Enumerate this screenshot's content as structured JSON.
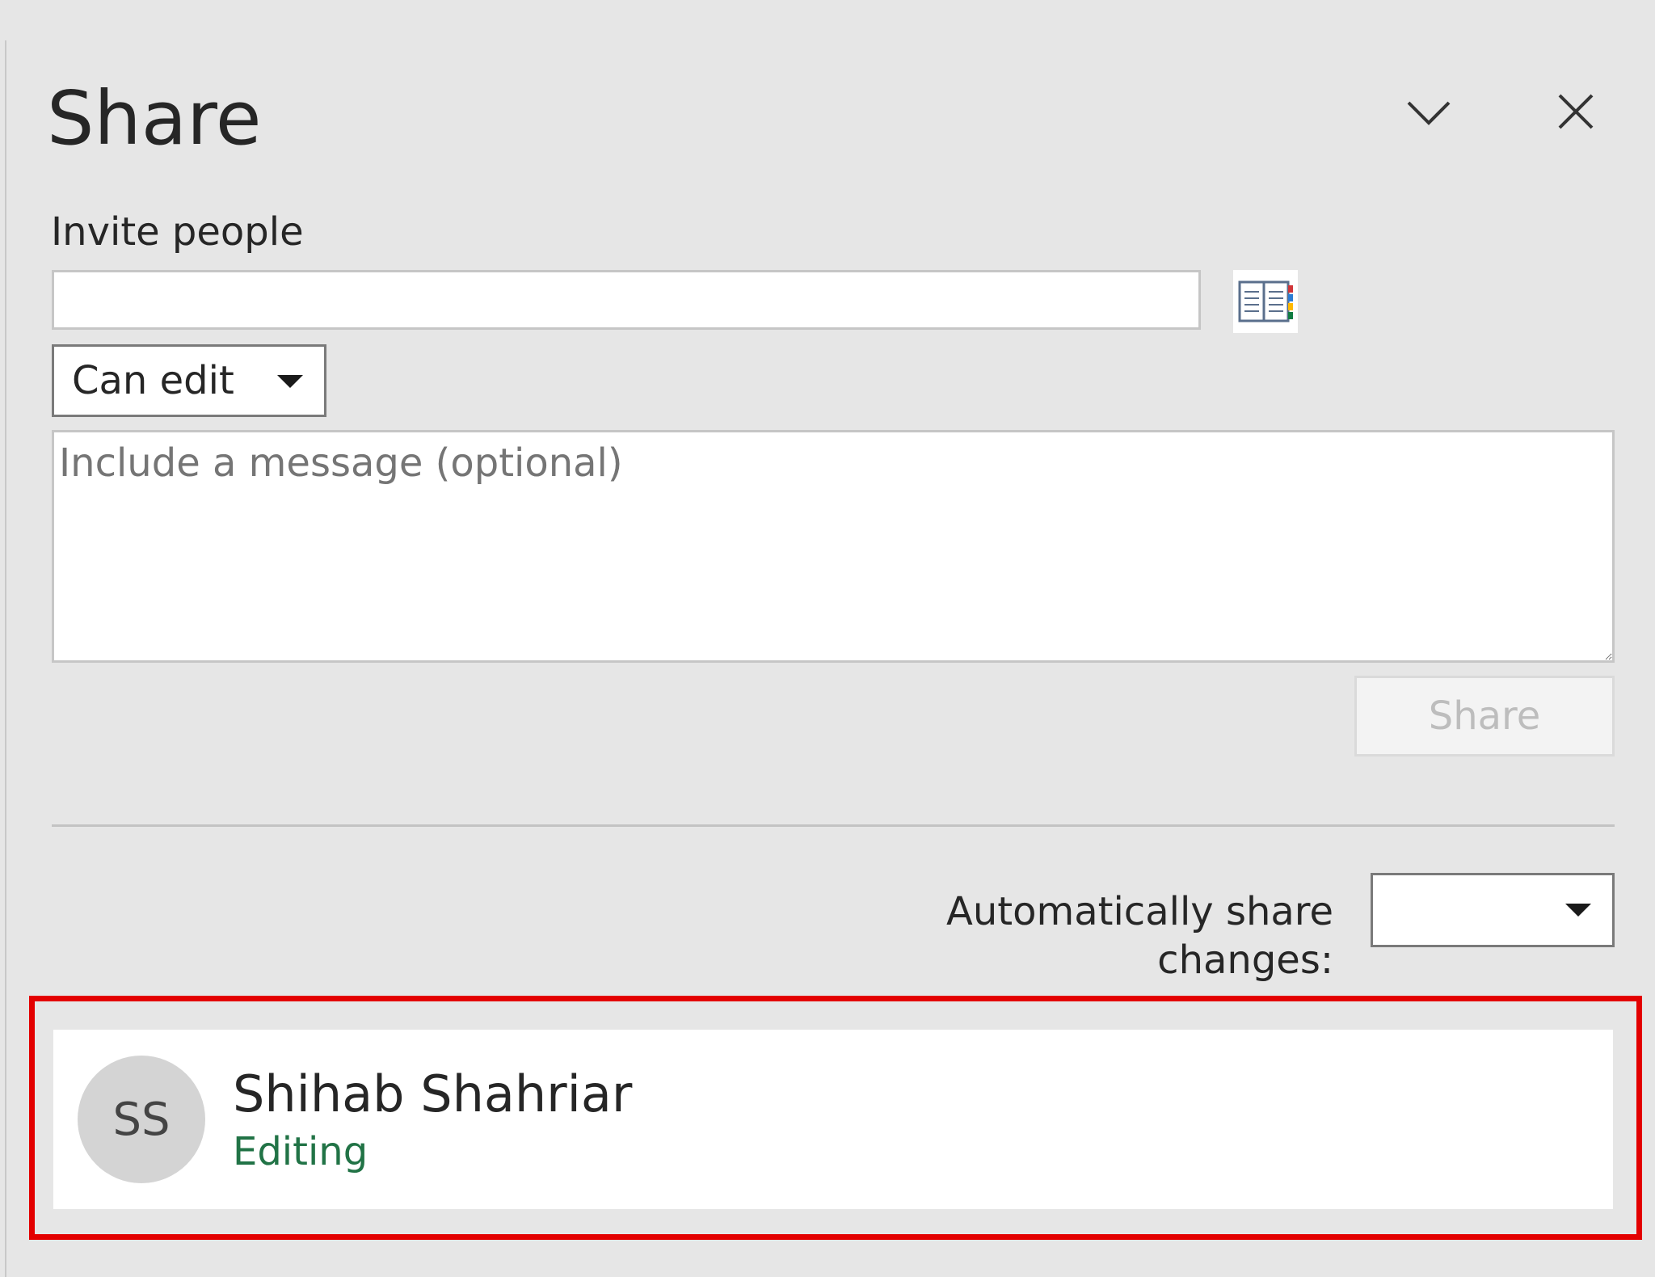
{
  "panel": {
    "title": "Share"
  },
  "invite": {
    "label": "Invite people",
    "value": "",
    "permission": "Can edit"
  },
  "message": {
    "placeholder": "Include a message (optional)"
  },
  "actions": {
    "share_label": "Share"
  },
  "auto_share": {
    "label": "Automatically share changes:",
    "value": ""
  },
  "people": [
    {
      "initials": "SS",
      "name": "Shihab Shahriar",
      "status": "Editing"
    }
  ],
  "colors": {
    "background": "#e6e6e6",
    "status_green": "#217346",
    "highlight_red": "#e30000"
  },
  "icons": {
    "collapse": "chevron-down-icon",
    "close": "close-icon",
    "address_book": "address-book-icon",
    "dropdown": "caret-down-icon"
  }
}
